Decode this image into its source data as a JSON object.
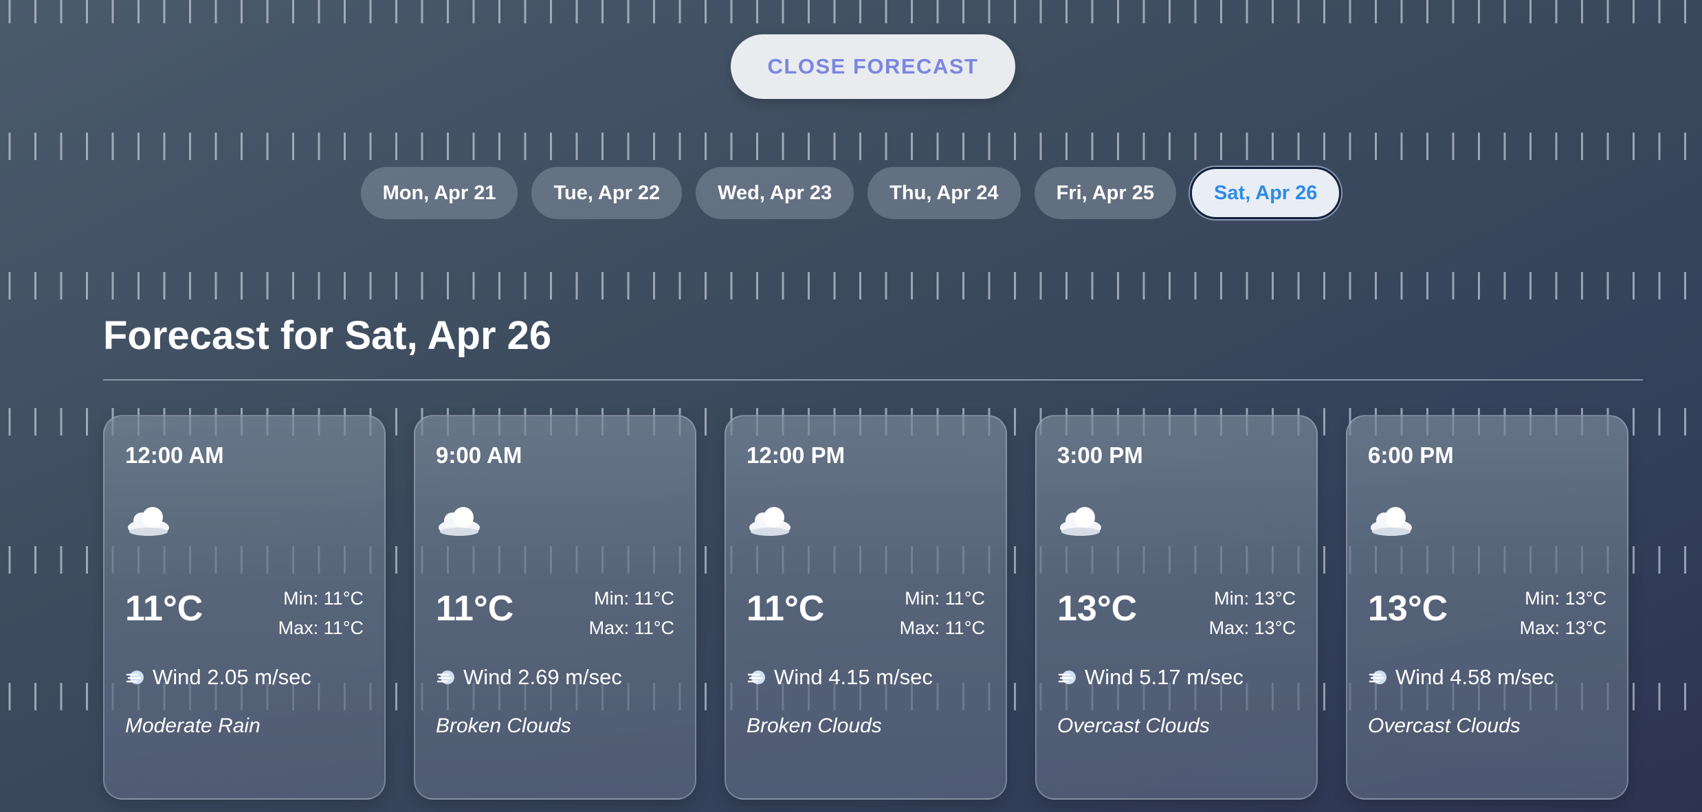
{
  "header": {
    "close_label": "CLOSE FORECAST"
  },
  "day_tabs": [
    {
      "label": "Mon, Apr 21",
      "active": false
    },
    {
      "label": "Tue, Apr 22",
      "active": false
    },
    {
      "label": "Wed, Apr 23",
      "active": false
    },
    {
      "label": "Thu, Apr 24",
      "active": false
    },
    {
      "label": "Fri, Apr 25",
      "active": false
    },
    {
      "label": "Sat, Apr 26",
      "active": true
    }
  ],
  "forecast": {
    "title": "Forecast for Sat, Apr 26",
    "cards": [
      {
        "time": "12:00 AM",
        "icon": "cloud-icon",
        "temp": "11°C",
        "min": "Min: 11°C",
        "max": "Max: 11°C",
        "wind": "Wind 2.05 m/sec",
        "description": "Moderate Rain"
      },
      {
        "time": "9:00 AM",
        "icon": "cloud-icon",
        "temp": "11°C",
        "min": "Min: 11°C",
        "max": "Max: 11°C",
        "wind": "Wind 2.69 m/sec",
        "description": "Broken Clouds"
      },
      {
        "time": "12:00 PM",
        "icon": "cloud-icon",
        "temp": "11°C",
        "min": "Min: 11°C",
        "max": "Max: 11°C",
        "wind": "Wind 4.15 m/sec",
        "description": "Broken Clouds"
      },
      {
        "time": "3:00 PM",
        "icon": "cloud-icon",
        "temp": "13°C",
        "min": "Min: 13°C",
        "max": "Max: 13°C",
        "wind": "Wind 5.17 m/sec",
        "description": "Overcast Clouds"
      },
      {
        "time": "6:00 PM",
        "icon": "cloud-icon",
        "temp": "13°C",
        "min": "Min: 13°C",
        "max": "Max: 13°C",
        "wind": "Wind 4.58 m/sec",
        "description": "Overcast Clouds"
      }
    ]
  },
  "colors": {
    "accent": "#2f8be6",
    "close_text": "#7b86e0",
    "background_start": "#4a5b6c",
    "background_end": "#2c3350"
  }
}
